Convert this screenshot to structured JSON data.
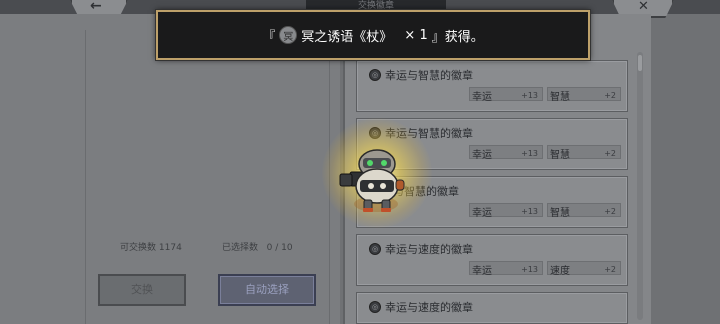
{
  "header": {
    "title": "交换徽章",
    "back_symbol": "←",
    "close_symbol": "✕"
  },
  "toast": {
    "bracket_open": "『",
    "item_name": "冥之诱语《杖》",
    "quantity": "× 1",
    "suffix": "』获得。",
    "icon_glyph": "冥"
  },
  "stats": {
    "exchangeable_label": "可交换数",
    "exchangeable_value": "1174",
    "selected_label": "已选择数",
    "selected_value": "0 /  10"
  },
  "buttons": {
    "exchange_label": "交换",
    "auto_select_label": "自动选择"
  },
  "badges": [
    {
      "name": "幸运与智慧的徽章",
      "stat_a": "幸运",
      "val_a": "+13",
      "stat_b": "智慧",
      "val_b": "+2"
    },
    {
      "name": "幸运与智慧的徽章",
      "stat_a": "幸运",
      "val_a": "+13",
      "stat_b": "智慧",
      "val_b": "+2"
    },
    {
      "name": "与智慧的徽章",
      "stat_a": "幸运",
      "val_a": "+13",
      "stat_b": "智慧",
      "val_b": "+2"
    },
    {
      "name": "幸运与速度的徽章",
      "stat_a": "幸运",
      "val_a": "+13",
      "stat_b": "速度",
      "val_b": "+2"
    },
    {
      "name": "幸运与速度的徽章",
      "stat_a": "",
      "val_a": "",
      "stat_b": "",
      "val_b": ""
    }
  ],
  "colors": {
    "toast_border": "#bda06a",
    "glow": "#f5d750",
    "auto_button": "#5e6272"
  }
}
